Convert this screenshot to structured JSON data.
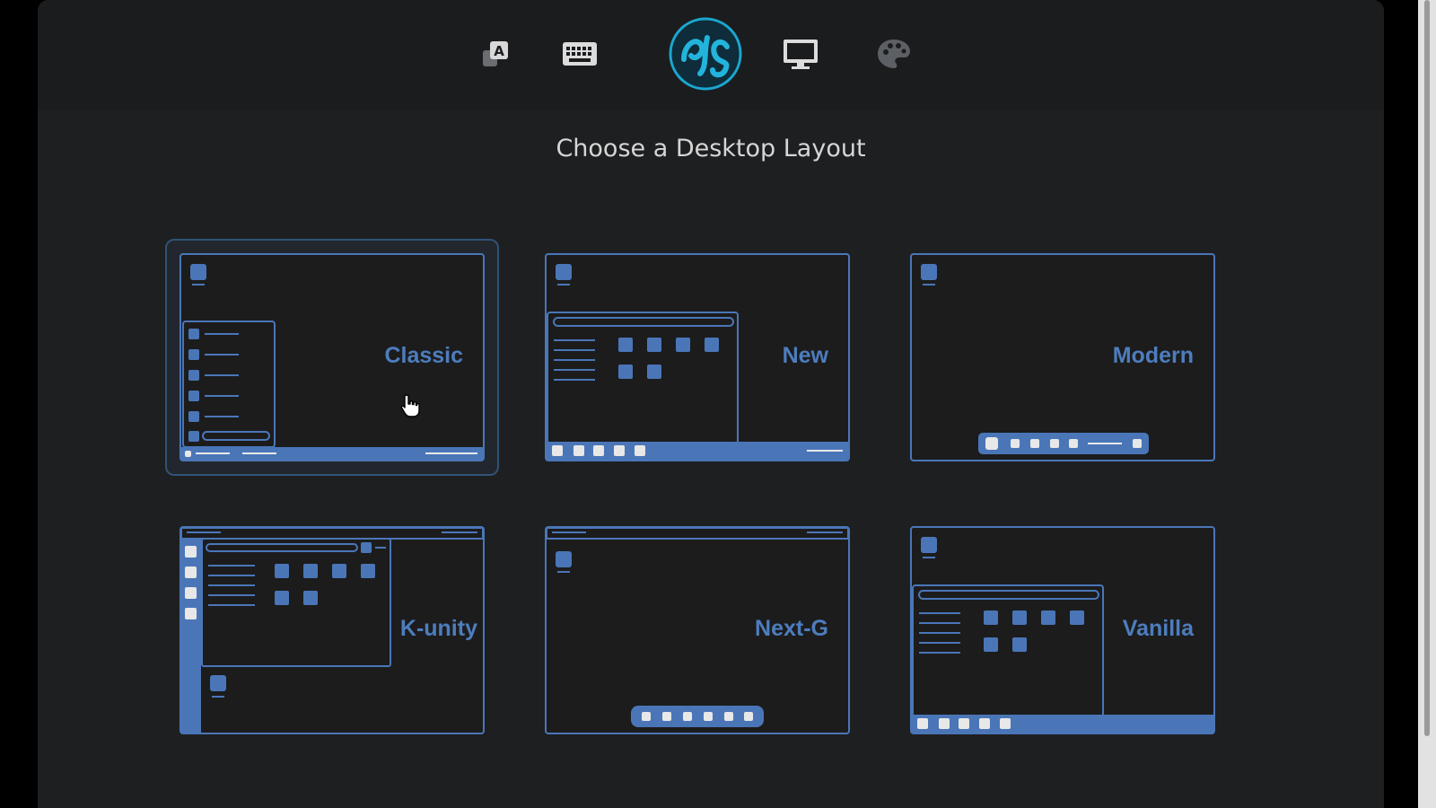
{
  "toolbar": {
    "icons": [
      {
        "name": "language-icon",
        "glyph": "A"
      },
      {
        "name": "keyboard-icon"
      },
      {
        "name": "bigcommunity-logo"
      },
      {
        "name": "display-icon"
      },
      {
        "name": "palette-icon"
      }
    ]
  },
  "page": {
    "title": "Choose a Desktop Layout"
  },
  "layouts": [
    {
      "id": "classic",
      "label": "Classic",
      "selected": true
    },
    {
      "id": "new",
      "label": "New",
      "selected": false
    },
    {
      "id": "modern",
      "label": "Modern",
      "selected": false
    },
    {
      "id": "k-unity",
      "label": "K-unity",
      "selected": false
    },
    {
      "id": "next-g",
      "label": "Next-G",
      "selected": false
    },
    {
      "id": "vanilla",
      "label": "Vanilla",
      "selected": false
    }
  ],
  "colors": {
    "accent": "#4a76b8",
    "card_bg": "#1c1c1d",
    "window_bg": "#1e1f21"
  }
}
